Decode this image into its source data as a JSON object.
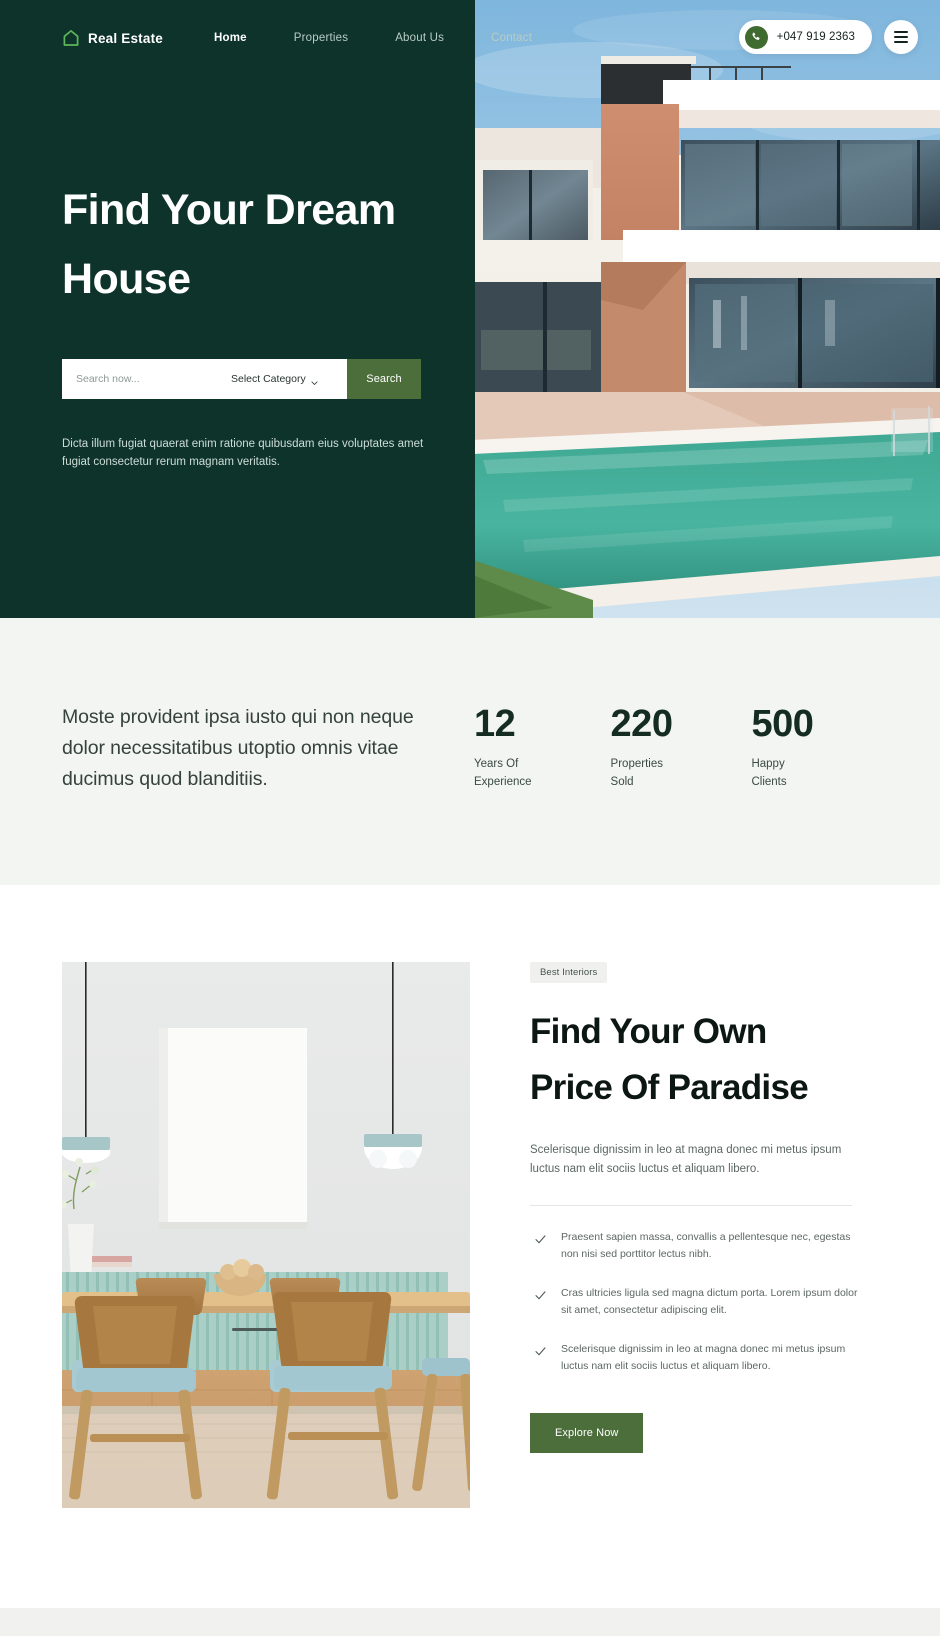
{
  "brand": {
    "name": "Real Estate",
    "logo_icon": "house-outline-icon",
    "accent_green": "#4c6e3b",
    "dark_green": "#0d332b"
  },
  "nav": {
    "links": [
      {
        "label": "Home",
        "active": true
      },
      {
        "label": "Properties",
        "active": false
      },
      {
        "label": "About Us",
        "active": false
      },
      {
        "label": "Contact",
        "active": false
      }
    ],
    "phone": "+047 919 2363",
    "phone_icon": "phone-icon",
    "menu_icon": "hamburger-menu-icon"
  },
  "hero": {
    "title_line1": "Find Your Dream",
    "title_line2": "House",
    "description": "Dicta illum fugiat quaerat enim ratione quibusdam eius voluptates amet fugiat consectetur rerum magnam veritatis.",
    "search": {
      "placeholder": "Search now...",
      "value": "",
      "category_label": "Select Category",
      "category_icon": "chevron-down-icon",
      "button_label": "Search"
    },
    "image_alt": "modern-villa-with-pool"
  },
  "stats": {
    "intro": "Moste provident ipsa iusto qui non neque dolor necessitatibus utoptio omnis vitae ducimus quod blanditiis.",
    "items": [
      {
        "value": "12",
        "label_line1": "Years Of",
        "label_line2": "Experience"
      },
      {
        "value": "220",
        "label_line1": "Properties",
        "label_line2": "Sold"
      },
      {
        "value": "500",
        "label_line1": "Happy",
        "label_line2": "Clients"
      }
    ]
  },
  "paradise": {
    "badge": "Best Interiors",
    "title_line1": "Find Your Own",
    "title_line2": "Price Of Paradise",
    "description": "Scelerisque dignissim in leo at magna donec mi metus ipsum luctus nam elit sociis luctus et aliquam libero.",
    "checklist": [
      "Praesent sapien massa, convallis a pellentesque nec, egestas non nisi sed porttitor lectus nibh.",
      "Cras ultricies ligula sed magna dictum porta. Lorem ipsum dolor sit amet, consectetur adipiscing elit.",
      "Scelerisque dignissim in leo at magna donec mi metus ipsum luctus nam elit sociis luctus et aliquam libero."
    ],
    "check_icon": "checkmark-icon",
    "button_label": "Explore Now",
    "image_alt": "dining-room-interior"
  }
}
